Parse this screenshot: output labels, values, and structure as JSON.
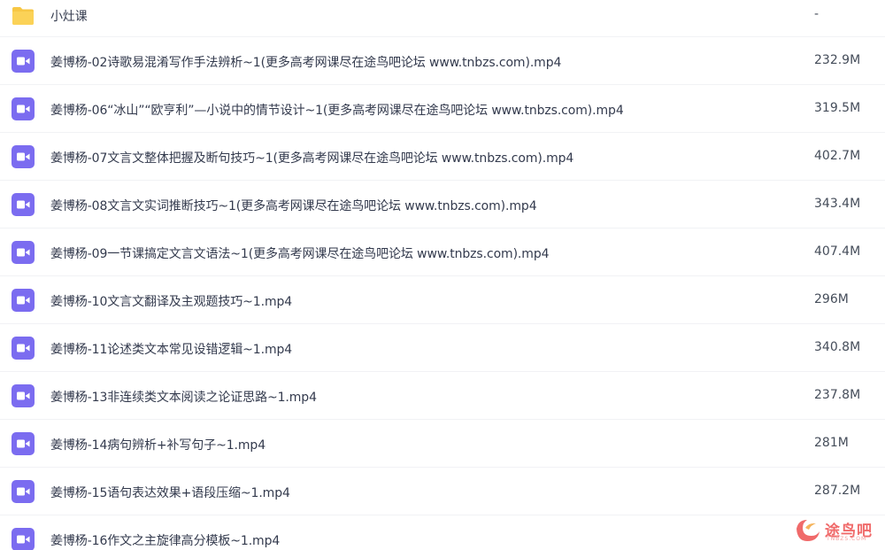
{
  "files": [
    {
      "name": "小灶课",
      "size": "-",
      "icon": "folder-icon"
    },
    {
      "name": "姜博杨-02诗歌易混淆写作手法辨析~1(更多高考网课尽在途鸟吧论坛 www.tnbzs.com).mp4",
      "size": "232.9M",
      "icon": "video-file-icon"
    },
    {
      "name": "姜博杨-06“冰山”“欧亨利”—小说中的情节设计~1(更多高考网课尽在途鸟吧论坛 www.tnbzs.com).mp4",
      "size": "319.5M",
      "icon": "video-file-icon"
    },
    {
      "name": "姜博杨-07文言文整体把握及断句技巧~1(更多高考网课尽在途鸟吧论坛 www.tnbzs.com).mp4",
      "size": "402.7M",
      "icon": "video-file-icon"
    },
    {
      "name": "姜博杨-08文言文实词推断技巧~1(更多高考网课尽在途鸟吧论坛 www.tnbzs.com).mp4",
      "size": "343.4M",
      "icon": "video-file-icon"
    },
    {
      "name": "姜博杨-09一节课搞定文言文语法~1(更多高考网课尽在途鸟吧论坛 www.tnbzs.com).mp4",
      "size": "407.4M",
      "icon": "video-file-icon"
    },
    {
      "name": "姜博杨-10文言文翻译及主观题技巧~1.mp4",
      "size": "296M",
      "icon": "video-file-icon"
    },
    {
      "name": "姜博杨-11论述类文本常见设错逻辑~1.mp4",
      "size": "340.8M",
      "icon": "video-file-icon"
    },
    {
      "name": "姜博杨-13非连续类文本阅读之论证思路~1.mp4",
      "size": "237.8M",
      "icon": "video-file-icon"
    },
    {
      "name": "姜博杨-14病句辨析+补写句子~1.mp4",
      "size": "281M",
      "icon": "video-file-icon"
    },
    {
      "name": "姜博杨-15语句表达效果+语段压缩~1.mp4",
      "size": "287.2M",
      "icon": "video-file-icon"
    },
    {
      "name": "姜博杨-16作文之主旋律高分模板~1.mp4",
      "size": "",
      "icon": "video-file-icon"
    }
  ],
  "watermark": {
    "text": "途鸟吧",
    "sub": "TNBZS.COM"
  },
  "colors": {
    "folder": "#f7c744",
    "video_icon": "#7b6cf0",
    "text": "#333a4d",
    "size_text": "#454d5a",
    "watermark": "#f06a6a"
  }
}
